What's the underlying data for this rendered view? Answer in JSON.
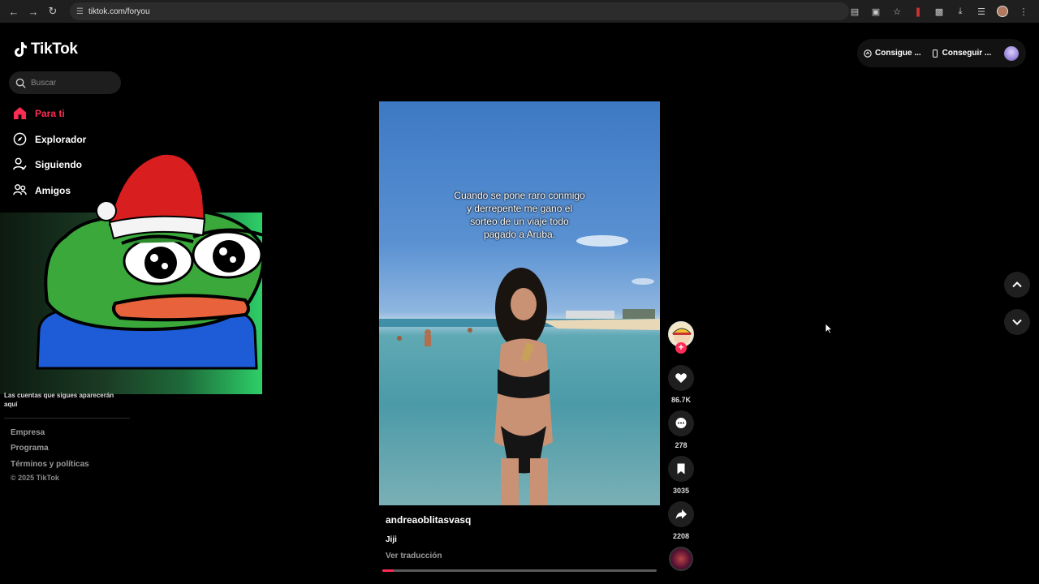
{
  "browser": {
    "url": "tiktok.com/foryou"
  },
  "brand": {
    "name": "TikTok"
  },
  "search": {
    "placeholder": "Buscar"
  },
  "nav": {
    "items": [
      {
        "label": "Para ti",
        "icon": "home-icon",
        "active": true
      },
      {
        "label": "Explorador",
        "icon": "compass-icon",
        "active": false
      },
      {
        "label": "Siguiendo",
        "icon": "following-icon",
        "active": false
      },
      {
        "label": "Amigos",
        "icon": "friends-icon",
        "active": false
      }
    ]
  },
  "sidebar": {
    "follow_note": "Las cuentas que sigues aparecerán aquí",
    "footer_links": [
      "Empresa",
      "Programa",
      "Términos y políticas"
    ],
    "copyright": "© 2025 TikTok"
  },
  "topbar": {
    "get_coins": "Consigue ...",
    "get_app": "Conseguir ..."
  },
  "video": {
    "caption_lines": [
      "Cuando se pone raro conmigo",
      "y derrepente me gano el",
      "sorteo de un viaje todo",
      "pagado a Aruba."
    ],
    "author": "andreaoblitasvasq",
    "description": "Jiji",
    "translate_label": "Ver traducción",
    "progress": 0.04
  },
  "actions": {
    "likes": "86.7K",
    "comments": "278",
    "saves": "3035",
    "shares": "2208"
  },
  "colors": {
    "accent": "#fe2c55",
    "background": "#000000"
  }
}
